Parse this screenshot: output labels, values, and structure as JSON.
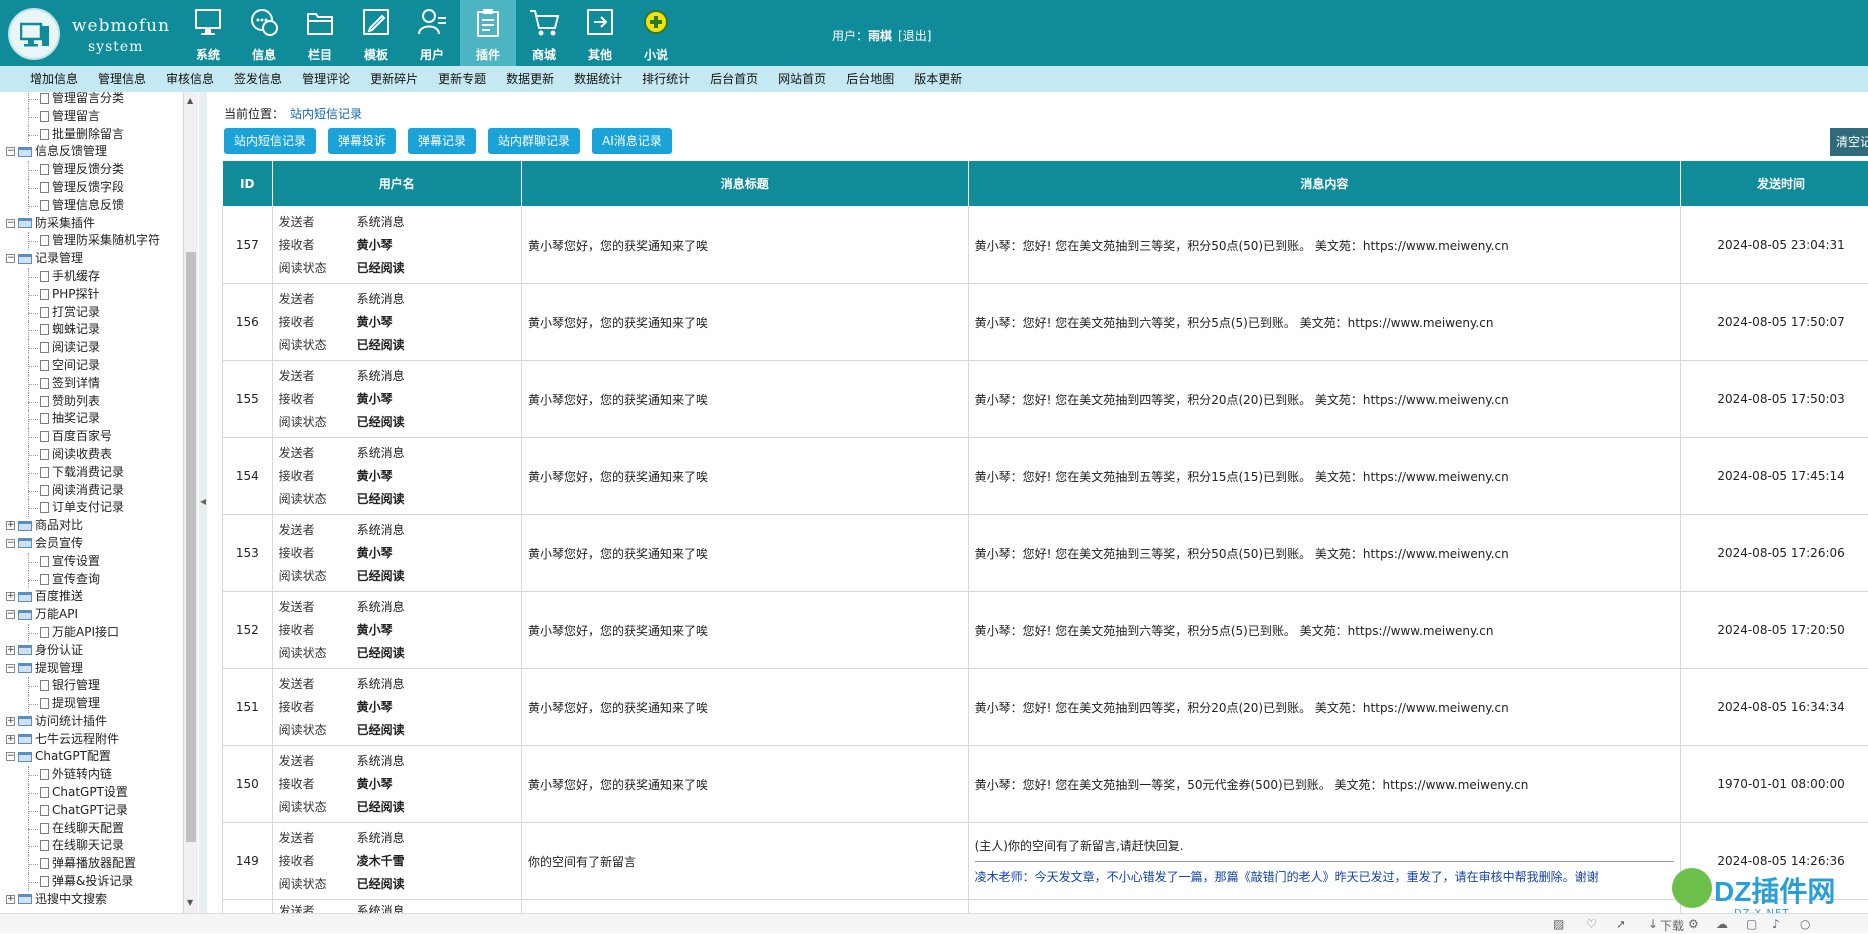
{
  "brand": {
    "line1": "webmofun",
    "line2": "system"
  },
  "nav": [
    {
      "label": "系统",
      "icon": "monitor-icon",
      "active": false
    },
    {
      "label": "信息",
      "icon": "chat-icon",
      "active": false
    },
    {
      "label": "栏目",
      "icon": "folder-icon",
      "active": false
    },
    {
      "label": "模板",
      "icon": "pen-icon",
      "active": false
    },
    {
      "label": "用户",
      "icon": "user-icon",
      "active": false
    },
    {
      "label": "插件",
      "icon": "clipboard-icon",
      "active": true
    },
    {
      "label": "商城",
      "icon": "cart-icon",
      "active": false
    },
    {
      "label": "其他",
      "icon": "exit-icon",
      "active": false
    },
    {
      "label": "小说",
      "icon": "plus-badge-icon",
      "active": false
    }
  ],
  "user": {
    "prefix": "用户：",
    "name": "雨棋",
    "logout": "[退出]"
  },
  "subnav": [
    "增加信息",
    "管理信息",
    "审核信息",
    "签发信息",
    "管理评论",
    "更新碎片",
    "更新专题",
    "数据更新",
    "数据统计",
    "排行统计",
    "后台首页",
    "网站首页",
    "后台地图",
    "版本更新"
  ],
  "tree": [
    {
      "label": "管理留言分类",
      "level": 2
    },
    {
      "label": "管理留言",
      "level": 2
    },
    {
      "label": "批量删除留言",
      "level": 2
    },
    {
      "label": "信息反馈管理",
      "level": 1,
      "exp": "-"
    },
    {
      "label": "管理反馈分类",
      "level": 2
    },
    {
      "label": "管理反馈字段",
      "level": 2
    },
    {
      "label": "管理信息反馈",
      "level": 2
    },
    {
      "label": "防采集插件",
      "level": 1,
      "exp": "-"
    },
    {
      "label": "管理防采集随机字符",
      "level": 2
    },
    {
      "label": "记录管理",
      "level": 1,
      "exp": "-"
    },
    {
      "label": "手机缓存",
      "level": 2
    },
    {
      "label": "PHP探针",
      "level": 2
    },
    {
      "label": "打赏记录",
      "level": 2
    },
    {
      "label": "蜘蛛记录",
      "level": 2
    },
    {
      "label": "阅读记录",
      "level": 2
    },
    {
      "label": "空间记录",
      "level": 2
    },
    {
      "label": "签到详情",
      "level": 2
    },
    {
      "label": "赞助列表",
      "level": 2
    },
    {
      "label": "抽奖记录",
      "level": 2
    },
    {
      "label": "百度百家号",
      "level": 2
    },
    {
      "label": "阅读收费表",
      "level": 2
    },
    {
      "label": "下载消费记录",
      "level": 2
    },
    {
      "label": "阅读消费记录",
      "level": 2
    },
    {
      "label": "订单支付记录",
      "level": 2
    },
    {
      "label": "商品对比",
      "level": 1,
      "exp": "+"
    },
    {
      "label": "会员宣传",
      "level": 1,
      "exp": "-"
    },
    {
      "label": "宣传设置",
      "level": 2
    },
    {
      "label": "宣传查询",
      "level": 2
    },
    {
      "label": "百度推送",
      "level": 1,
      "exp": "+"
    },
    {
      "label": "万能API",
      "level": 1,
      "exp": "-"
    },
    {
      "label": "万能API接口",
      "level": 2
    },
    {
      "label": "身份认证",
      "level": 1,
      "exp": "+"
    },
    {
      "label": "提现管理",
      "level": 1,
      "exp": "-"
    },
    {
      "label": "银行管理",
      "level": 2
    },
    {
      "label": "提现管理",
      "level": 2
    },
    {
      "label": "访问统计插件",
      "level": 1,
      "exp": "+"
    },
    {
      "label": "七牛云远程附件",
      "level": 1,
      "exp": "+"
    },
    {
      "label": "ChatGPT配置",
      "level": 1,
      "exp": "-"
    },
    {
      "label": "外链转内链",
      "level": 2
    },
    {
      "label": "ChatGPT设置",
      "level": 2
    },
    {
      "label": "ChatGPT记录",
      "level": 2
    },
    {
      "label": "在线聊天配置",
      "level": 2
    },
    {
      "label": "在线聊天记录",
      "level": 2
    },
    {
      "label": "弹幕播放器配置",
      "level": 2
    },
    {
      "label": "弹幕&投诉记录",
      "level": 2
    },
    {
      "label": "迅搜中文搜索",
      "level": 1,
      "exp": "+"
    }
  ],
  "breadcrumb": {
    "label": "当前位置：",
    "link": "站内短信记录"
  },
  "buttons": [
    "站内短信记录",
    "弹幕投诉",
    "弹幕记录",
    "站内群聊记录",
    "AI消息记录"
  ],
  "clear_button": "清空记",
  "table": {
    "headers": [
      "ID",
      "用户名",
      "消息标题",
      "消息内容",
      "发送时间"
    ],
    "meta_keys": [
      "发送者",
      "接收者",
      "阅读状态"
    ],
    "rows": [
      {
        "id": "157",
        "sender": "系统消息",
        "receiver": "黄小琴",
        "status": "已经阅读",
        "title": "黄小琴您好，您的获奖通知来了唉",
        "body": "黄小琴：您好! 您在美文苑抽到三等奖，积分50点(50)已到账。 美文苑：https://www.meiweny.cn",
        "time": "2024-08-05 23:04:31"
      },
      {
        "id": "156",
        "sender": "系统消息",
        "receiver": "黄小琴",
        "status": "已经阅读",
        "title": "黄小琴您好，您的获奖通知来了唉",
        "body": "黄小琴：您好! 您在美文苑抽到六等奖，积分5点(5)已到账。 美文苑：https://www.meiweny.cn",
        "time": "2024-08-05 17:50:07"
      },
      {
        "id": "155",
        "sender": "系统消息",
        "receiver": "黄小琴",
        "status": "已经阅读",
        "title": "黄小琴您好，您的获奖通知来了唉",
        "body": "黄小琴：您好! 您在美文苑抽到四等奖，积分20点(20)已到账。 美文苑：https://www.meiweny.cn",
        "time": "2024-08-05 17:50:03"
      },
      {
        "id": "154",
        "sender": "系统消息",
        "receiver": "黄小琴",
        "status": "已经阅读",
        "title": "黄小琴您好，您的获奖通知来了唉",
        "body": "黄小琴：您好! 您在美文苑抽到五等奖，积分15点(15)已到账。 美文苑：https://www.meiweny.cn",
        "time": "2024-08-05 17:45:14"
      },
      {
        "id": "153",
        "sender": "系统消息",
        "receiver": "黄小琴",
        "status": "已经阅读",
        "title": "黄小琴您好，您的获奖通知来了唉",
        "body": "黄小琴：您好! 您在美文苑抽到三等奖，积分50点(50)已到账。 美文苑：https://www.meiweny.cn",
        "time": "2024-08-05 17:26:06"
      },
      {
        "id": "152",
        "sender": "系统消息",
        "receiver": "黄小琴",
        "status": "已经阅读",
        "title": "黄小琴您好，您的获奖通知来了唉",
        "body": "黄小琴：您好! 您在美文苑抽到六等奖，积分5点(5)已到账。 美文苑：https://www.meiweny.cn",
        "time": "2024-08-05 17:20:50"
      },
      {
        "id": "151",
        "sender": "系统消息",
        "receiver": "黄小琴",
        "status": "已经阅读",
        "title": "黄小琴您好，您的获奖通知来了唉",
        "body": "黄小琴：您好! 您在美文苑抽到四等奖，积分20点(20)已到账。 美文苑：https://www.meiweny.cn",
        "time": "2024-08-05 16:34:34"
      },
      {
        "id": "150",
        "sender": "系统消息",
        "receiver": "黄小琴",
        "status": "已经阅读",
        "title": "黄小琴您好，您的获奖通知来了唉",
        "body": "黄小琴：您好! 您在美文苑抽到一等奖，50元代金券(500)已到账。 美文苑：https://www.meiweny.cn",
        "time": "1970-01-01 08:00:00"
      },
      {
        "id": "149",
        "sender": "系统消息",
        "receiver": "凌木千雪",
        "status": "已经阅读",
        "title": "你的空间有了新留言",
        "body": "(主人)你的空间有了新留言,请赶快回复.",
        "body2": "凌木老师：今天发文章，不小心错发了一篇，那篇《敲错门的老人》昨天已发过，重发了，请在审核中帮我删除。谢谢",
        "time": "2024-08-05 14:26:36"
      }
    ],
    "partial_row": {
      "sender_key": "发送者",
      "sender": "系统消息"
    }
  },
  "watermark": {
    "text": "DZ插件网",
    "sub": "DZ-X.NET"
  },
  "footer_icons": [
    "image-icon",
    "heart-icon",
    "rocket-icon",
    "download-icon",
    "settings-icon",
    "cloud-icon",
    "window-icon",
    "volume-icon",
    "search-icon"
  ],
  "footer": {
    "download_label": "下载"
  },
  "colors": {
    "header": "#0f8b99",
    "subnav": "#c4e9f3",
    "button": "#1aa3d8",
    "active_nav": "#4db4c1"
  }
}
